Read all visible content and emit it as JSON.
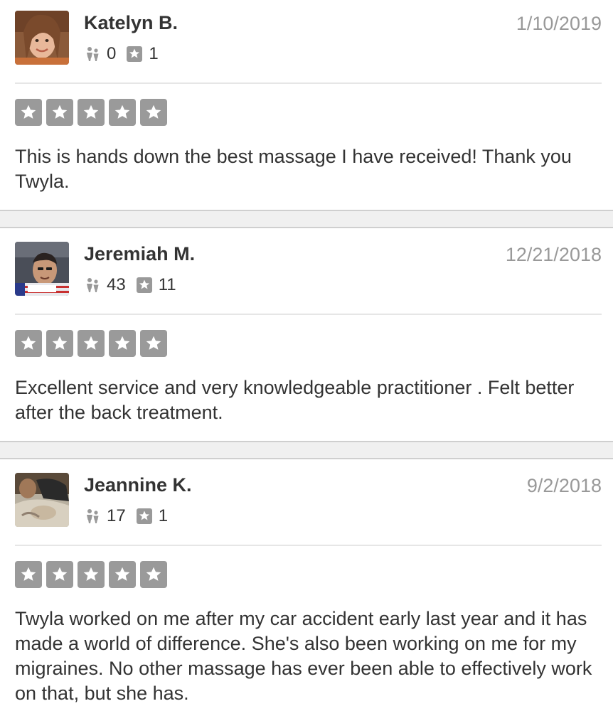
{
  "reviews": [
    {
      "name": "Katelyn B.",
      "date": "1/10/2019",
      "friends": "0",
      "review_count": "1",
      "rating": 5,
      "text": "This is hands down the best massage I have received!  Thank you Twyla."
    },
    {
      "name": "Jeremiah M.",
      "date": "12/21/2018",
      "friends": "43",
      "review_count": "11",
      "rating": 5,
      "text": "Excellent service and very knowledgeable practitioner . Felt better after the back treatment."
    },
    {
      "name": "Jeannine K.",
      "date": "9/2/2018",
      "friends": "17",
      "review_count": "1",
      "rating": 5,
      "text": "Twyla worked on me after my car accident early last year and it has made a world of difference. She's also been working on me for my migraines. No other massage has ever been able to effectively work on that, but she has."
    }
  ],
  "icons": {
    "friends": "friends-icon",
    "reviews": "review-star-icon",
    "rating": "star-icon"
  },
  "colors": {
    "star_box": "#9a9a9a",
    "date_text": "#999999",
    "separator": "#f0f0f0"
  }
}
